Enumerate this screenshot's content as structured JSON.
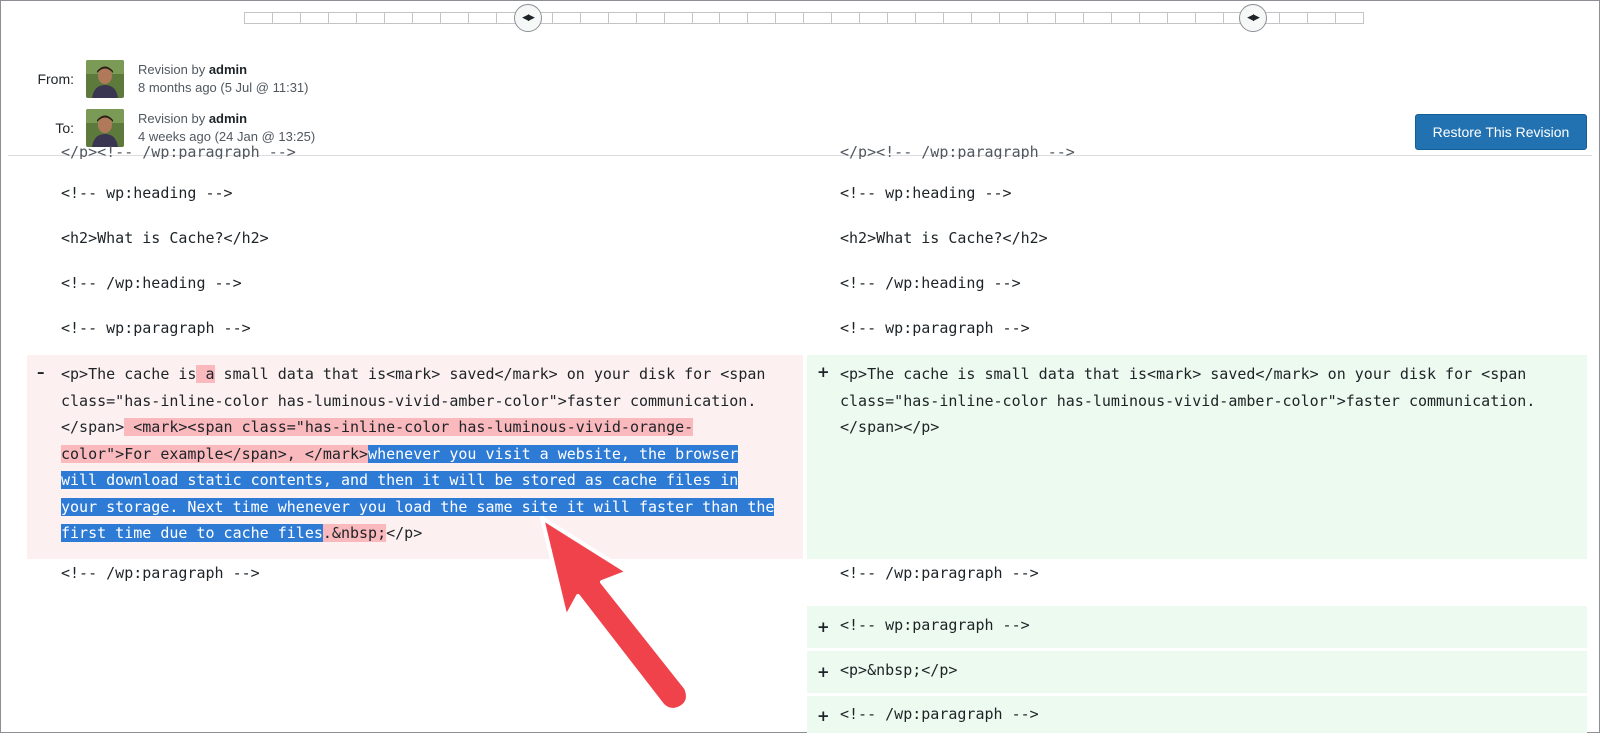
{
  "header": {
    "from_label": "From:",
    "to_label": "To:",
    "from": {
      "prefix": "Revision by ",
      "author": "admin",
      "when": "8 months ago (5 Jul @ 11:31)"
    },
    "to": {
      "prefix": "Revision by ",
      "author": "admin",
      "when": "4 weeks ago (24 Jan @ 13:25)"
    },
    "restore_label": "Restore This Revision"
  },
  "slider": {
    "tick_count": 40,
    "handles": [
      "left-handle",
      "right-handle"
    ]
  },
  "diff": {
    "left": {
      "cut_top": "</p><!-- /wp:paragraph -->",
      "heading_open": "<!-- wp:heading -->",
      "h2": "<h2>What is Cache?</h2>",
      "heading_close": "<!-- /wp:heading -->",
      "para_open": "<!-- wp:paragraph -->",
      "del_symbol": "–",
      "del_parts": {
        "p1": "<p>The cache is",
        "p2": " a",
        "p3": " small data that is<mark> saved</mark> on your disk for <span class=\"has-inline-color has-luminous-vivid-amber-color\">faster communication.</span>",
        "p4": " <mark><span class=\"has-inline-color has-luminous-vivid-orange-color\">For example</span>, </mark>",
        "p5": "whenever you visit a website, the browser will download static contents, and then it will be stored as cache files in your storage. Next time whenever you load the same site it will faster than the first time due to cache files",
        "p6": ".&nbsp;",
        "p7": "</p>"
      },
      "para_close": "<!-- /wp:paragraph -->"
    },
    "right": {
      "cut_top": "</p><!-- /wp:paragraph -->",
      "heading_open": "<!-- wp:heading -->",
      "h2": "<h2>What is Cache?</h2>",
      "heading_close": "<!-- /wp:heading -->",
      "para_open": "<!-- wp:paragraph -->",
      "add_symbol": "+",
      "add_para": "<p>The cache is small data that is<mark> saved</mark> on your disk for <span class=\"has-inline-color has-luminous-vivid-amber-color\">faster communication.</span></p>",
      "para_close": "<!-- /wp:paragraph -->",
      "added_rows": [
        "<!-- wp:paragraph -->",
        "<p>&nbsp;</p>",
        "<!-- /wp:paragraph -->"
      ]
    }
  },
  "colors": {
    "accent": "#2271b1",
    "deleted_bg": "#fcf0f1",
    "deleted_highlight": "#f9b9bd",
    "added_bg": "#edfaef",
    "selection": "#2e7bd6",
    "arrow": "#f0424a"
  }
}
